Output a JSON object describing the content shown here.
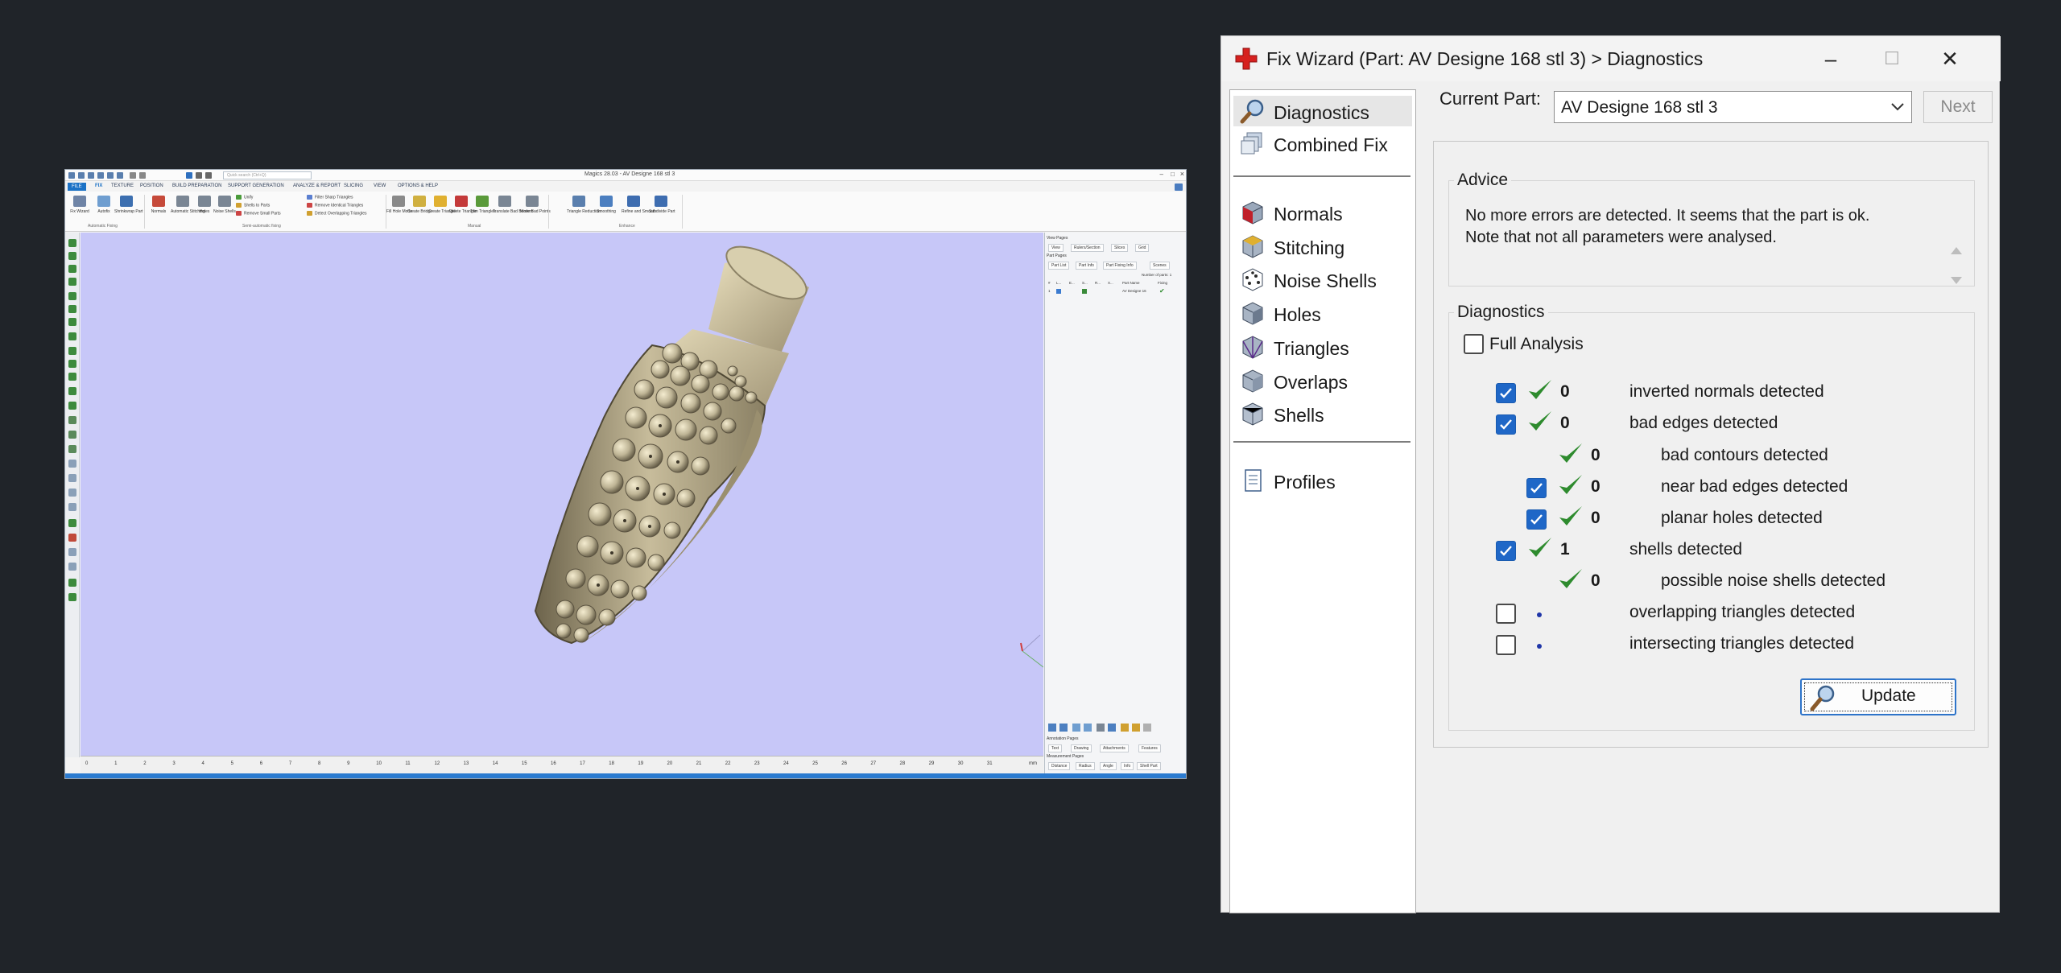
{
  "magics": {
    "title": "Magics 28.03 - AV Designe 168 stl 3",
    "search_placeholder": "Quick search (Ctrl+Q)",
    "tabs": [
      "FILE",
      "FIX",
      "TEXTURE",
      "POSITION",
      "BUILD PREPARATION",
      "SUPPORT GENERATION",
      "ANALYZE & REPORT",
      "SLICING",
      "VIEW",
      "OPTIONS & HELP"
    ],
    "ribbon_buttons": [
      {
        "label": "Fix Wizard"
      },
      {
        "label": "Autofix"
      },
      {
        "label": "Shrinkwrap Part"
      },
      {
        "label": "Normals"
      },
      {
        "label": "Automatic Stitching"
      },
      {
        "label": "Holes"
      },
      {
        "label": "Noise Shells"
      },
      {
        "label": "Fill Hole Mode"
      },
      {
        "label": "Create Bridge"
      },
      {
        "label": "Create Triangle"
      },
      {
        "label": "Delete Triangle"
      },
      {
        "label": "Trim Triangles"
      },
      {
        "label": "Translate Bad Borders"
      },
      {
        "label": "Move Bad Points"
      },
      {
        "label": "Triangle Reduction"
      },
      {
        "label": "Smoothing"
      },
      {
        "label": "Refine and Smooth"
      },
      {
        "label": "Subdivide Part"
      }
    ],
    "ribbon_lines": [
      "Unify",
      "Shells to Parts",
      "Remove Small Parts",
      "Filter Sharp Triangles",
      "Remove Identical Triangles",
      "Detect Overlapping Triangles"
    ],
    "ribbon_groups": [
      "Automatic Fixing",
      "Semi-automatic fixing",
      "Manual",
      "Enhance"
    ],
    "ruler_ticks": [
      "0",
      "1",
      "2",
      "3",
      "4",
      "5",
      "6",
      "7",
      "8",
      "9",
      "10",
      "11",
      "12",
      "13",
      "14",
      "15",
      "16",
      "17",
      "18",
      "19",
      "20",
      "21",
      "22",
      "23",
      "24",
      "25",
      "26",
      "27",
      "28",
      "29",
      "30",
      "31"
    ],
    "ruler_unit": "mm",
    "right_panel": {
      "view_pages": "View Pages",
      "view_tabs": [
        "View",
        "Rulers/Section",
        "Slices",
        "Grid"
      ],
      "part_pages": "Part Pages",
      "part_tabs": [
        "Part List",
        "Part Info",
        "Part Fixing Info",
        "Scenes"
      ],
      "number_of_parts": "Number of parts: 1",
      "columns": [
        "#",
        "L...",
        "E...",
        "S...",
        "R...",
        "X...",
        "Part Name",
        "Fixing"
      ],
      "row": [
        "1",
        "AV Designe 16"
      ],
      "annotation_pages": "Annotation Pages",
      "annotation_tabs": [
        "Text",
        "Drawing",
        "Attachments",
        "Features"
      ],
      "measurement_pages": "Measurement Pages",
      "measurement_tabs": [
        "Distance",
        "Radius",
        "Angle",
        "Info",
        "Shell Part"
      ]
    },
    "colors": {
      "viewport_bg": "#c7c7f8",
      "model": "#bfb596",
      "accent": "#1c72c6"
    }
  },
  "wizard": {
    "title": "Fix Wizard (Part: AV Designe 168 stl 3) > Diagnostics",
    "nav_top": [
      {
        "label": "Diagnostics",
        "icon": "magnifier-icon",
        "selected": true
      },
      {
        "label": "Combined Fix",
        "icon": "combined-fix-icon",
        "selected": false
      }
    ],
    "nav_mid": [
      {
        "label": "Normals",
        "icon": "normals-cube-icon"
      },
      {
        "label": "Stitching",
        "icon": "stitching-cube-icon"
      },
      {
        "label": "Noise Shells",
        "icon": "noise-shells-icon"
      },
      {
        "label": "Holes",
        "icon": "holes-cube-icon"
      },
      {
        "label": "Triangles",
        "icon": "triangles-cube-icon"
      },
      {
        "label": "Overlaps",
        "icon": "overlaps-cube-icon"
      },
      {
        "label": "Shells",
        "icon": "shells-cube-icon"
      }
    ],
    "nav_bottom": [
      {
        "label": "Profiles",
        "icon": "profiles-document-icon"
      }
    ],
    "current_part_label": "Current Part:",
    "current_part_value": "AV Designe 168 stl 3",
    "next_label": "Next",
    "advice_title": "Advice",
    "advice_text": "No more errors are detected. It seems that the part is ok.\nNote that not all parameters were analysed.",
    "diagnostics_title": "Diagnostics",
    "full_analysis_label": "Full Analysis",
    "full_analysis_checked": false,
    "rows": [
      {
        "checkbox": true,
        "checked": true,
        "status": "ok",
        "count": "0",
        "label": "inverted normals detected",
        "indent": 0
      },
      {
        "checkbox": true,
        "checked": true,
        "status": "ok",
        "count": "0",
        "label": "bad edges detected",
        "indent": 0
      },
      {
        "checkbox": false,
        "checked": false,
        "status": "ok",
        "count": "0",
        "label": "bad contours detected",
        "indent": 1
      },
      {
        "checkbox": true,
        "checked": true,
        "status": "ok",
        "count": "0",
        "label": "near bad edges detected",
        "indent": 1
      },
      {
        "checkbox": true,
        "checked": true,
        "status": "ok",
        "count": "0",
        "label": "planar holes detected",
        "indent": 1
      },
      {
        "checkbox": true,
        "checked": true,
        "status": "ok",
        "count": "1",
        "label": "shells detected",
        "indent": 0
      },
      {
        "checkbox": false,
        "checked": false,
        "status": "ok",
        "count": "0",
        "label": "possible noise shells detected",
        "indent": 1
      },
      {
        "checkbox": true,
        "checked": false,
        "status": "none",
        "count": "",
        "label": "overlapping triangles detected",
        "indent": 0
      },
      {
        "checkbox": true,
        "checked": false,
        "status": "none",
        "count": "",
        "label": "intersecting triangles detected",
        "indent": 0
      }
    ],
    "update_label": "Update",
    "colors": {
      "check_green": "#2e8b2e",
      "checkbox_blue": "#1f67c7",
      "title_cross": "#d6201e"
    }
  }
}
